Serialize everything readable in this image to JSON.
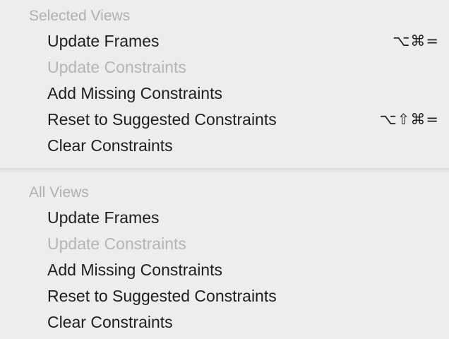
{
  "menu": {
    "selected_views": {
      "header": "Selected Views",
      "items": [
        {
          "label": "Update Frames",
          "enabled": true,
          "shortcut": "⌥⌘="
        },
        {
          "label": "Update Constraints",
          "enabled": false,
          "shortcut": ""
        },
        {
          "label": "Add Missing Constraints",
          "enabled": true,
          "shortcut": ""
        },
        {
          "label": "Reset to Suggested Constraints",
          "enabled": true,
          "shortcut": "⌥⇧⌘="
        },
        {
          "label": "Clear Constraints",
          "enabled": true,
          "shortcut": ""
        }
      ]
    },
    "all_views": {
      "header": "All Views",
      "items": [
        {
          "label": "Update Frames",
          "enabled": true
        },
        {
          "label": "Update Constraints",
          "enabled": false
        },
        {
          "label": "Add Missing Constraints",
          "enabled": true
        },
        {
          "label": "Reset to Suggested Constraints",
          "enabled": true
        },
        {
          "label": "Clear Constraints",
          "enabled": true
        }
      ]
    }
  }
}
